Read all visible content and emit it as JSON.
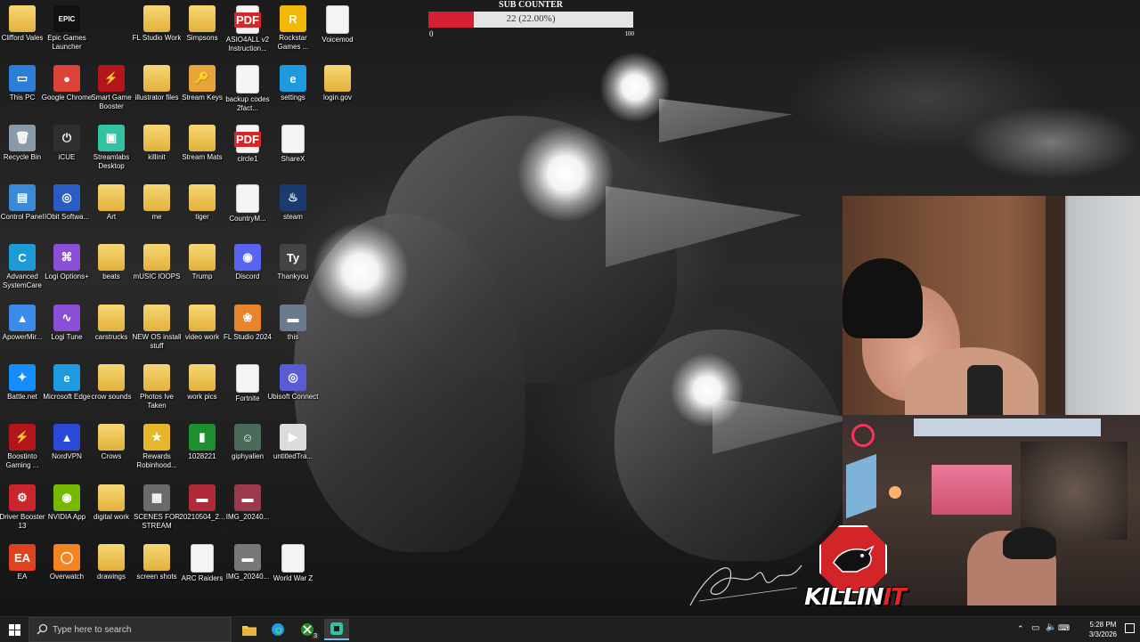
{
  "desktop": {
    "icons": [
      {
        "label": "Clifford Vales",
        "type": "folder"
      },
      {
        "label": "Epic Games Launcher",
        "type": "app",
        "glyph": "EPIC",
        "color": "#111111"
      },
      {
        "label": "FL Studio Work",
        "type": "folder"
      },
      {
        "label": "Simpsons",
        "type": "folder"
      },
      {
        "label": "ASIO4ALL v2 Instruction...",
        "type": "pdf"
      },
      {
        "label": "Rockstar Games ...",
        "type": "app",
        "glyph": "R",
        "color": "#f2b807"
      },
      {
        "label": "Voicemod",
        "type": "file"
      },
      {
        "label": "This PC",
        "type": "app",
        "glyph": "▭",
        "color": "#2b7fd6"
      },
      {
        "label": "Google Chrome",
        "type": "round",
        "glyph": "●",
        "color": "#db4437"
      },
      {
        "label": "Smart Game Booster",
        "type": "round",
        "glyph": "⚡",
        "color": "#b3151b"
      },
      {
        "label": "illustrator files",
        "type": "folder"
      },
      {
        "label": "Stream Keys",
        "type": "app",
        "glyph": "🔑",
        "color": "#e8a33a"
      },
      {
        "label": "backup codes 2fact...",
        "type": "file"
      },
      {
        "label": "settings",
        "type": "round",
        "glyph": "e",
        "color": "#1e9be0"
      },
      {
        "label": "login.gov",
        "type": "folder"
      },
      {
        "label": "Recycle Bin",
        "type": "app",
        "glyph": "🗑",
        "color": "#8a9aa8"
      },
      {
        "label": "iCUE",
        "type": "round",
        "glyph": "⏻",
        "color": "#2f2f2f"
      },
      {
        "label": "Streamlabs Desktop",
        "type": "app",
        "glyph": "▣",
        "color": "#31c3a2"
      },
      {
        "label": "killinit",
        "type": "folder"
      },
      {
        "label": "Stream Mats",
        "type": "folder"
      },
      {
        "label": "circle1",
        "type": "pdf"
      },
      {
        "label": "ShareX",
        "type": "file"
      },
      {
        "label": "Control Panel",
        "type": "app",
        "glyph": "▤",
        "color": "#3a8ad8"
      },
      {
        "label": "IObit Softwa...",
        "type": "round",
        "glyph": "◎",
        "color": "#2a5cc4"
      },
      {
        "label": "Art",
        "type": "folder"
      },
      {
        "label": "me",
        "type": "folder"
      },
      {
        "label": "tiger",
        "type": "folder"
      },
      {
        "label": "CountryM...",
        "type": "file"
      },
      {
        "label": "steam",
        "type": "round",
        "glyph": "♨",
        "color": "#1b3b6f"
      },
      {
        "label": "Advanced SystemCare",
        "type": "round",
        "glyph": "C",
        "color": "#1d9bd7"
      },
      {
        "label": "Logi Options+",
        "type": "app",
        "glyph": "⌘",
        "color": "#8a4fd6"
      },
      {
        "label": "beats",
        "type": "folder"
      },
      {
        "label": "mUSIC lOOPS",
        "type": "folder"
      },
      {
        "label": "Trump",
        "type": "folder"
      },
      {
        "label": "Discord",
        "type": "round",
        "glyph": "◉",
        "color": "#5865f2"
      },
      {
        "label": "Thankyou",
        "type": "app",
        "glyph": "Ty",
        "color": "#444444"
      },
      {
        "label": "ApowerMir...",
        "type": "app",
        "glyph": "▲",
        "color": "#3d8be8"
      },
      {
        "label": "Logi Tune",
        "type": "round",
        "glyph": "∿",
        "color": "#8a4fd6"
      },
      {
        "label": "carstrucks",
        "type": "folder"
      },
      {
        "label": "NEW OS install stuff",
        "type": "folder"
      },
      {
        "label": "video work",
        "type": "folder"
      },
      {
        "label": "FL Studio 2024",
        "type": "round",
        "glyph": "❀",
        "color": "#e8842a"
      },
      {
        "label": "this",
        "type": "app",
        "glyph": "▬",
        "color": "#6b7a8c"
      },
      {
        "label": "Battle.net",
        "type": "round",
        "glyph": "✦",
        "color": "#148eff"
      },
      {
        "label": "Microsoft Edge",
        "type": "round",
        "glyph": "e",
        "color": "#1e9be0"
      },
      {
        "label": "crow sounds",
        "type": "folder"
      },
      {
        "label": "Photos Ive Taken",
        "type": "folder"
      },
      {
        "label": "work pics",
        "type": "folder"
      },
      {
        "label": "Fortnite",
        "type": "file"
      },
      {
        "label": "Ubisoft Connect",
        "type": "round",
        "glyph": "◎",
        "color": "#5b5bd6"
      },
      {
        "label": "Boostinto Gaming ...",
        "type": "round",
        "glyph": "⚡",
        "color": "#b3151b"
      },
      {
        "label": "NordVPN",
        "type": "round",
        "glyph": "▲",
        "color": "#2a49d6"
      },
      {
        "label": "Crows",
        "type": "folder"
      },
      {
        "label": "Rewards Robinhood...",
        "type": "app",
        "glyph": "★",
        "color": "#e8b62a"
      },
      {
        "label": "1028221",
        "type": "app",
        "glyph": "▮",
        "color": "#1d8f2e"
      },
      {
        "label": "giphyalien",
        "type": "app",
        "glyph": "☺",
        "color": "#4a6a5a"
      },
      {
        "label": "untitledTra...",
        "type": "app",
        "glyph": "▶",
        "color": "#dcdcdc"
      },
      {
        "label": "Driver Booster 13",
        "type": "round",
        "glyph": "⚙",
        "color": "#c9252c"
      },
      {
        "label": "NVIDIA App",
        "type": "app",
        "glyph": "◉",
        "color": "#76b900"
      },
      {
        "label": "digital work",
        "type": "folder"
      },
      {
        "label": "SCENES FOR STREAM",
        "type": "app",
        "glyph": "▦",
        "color": "#6a6a6a"
      },
      {
        "label": "20210504_2...",
        "type": "app",
        "glyph": "▬",
        "color": "#b02a3a"
      },
      {
        "label": "IMG_20240...",
        "type": "app",
        "glyph": "▬",
        "color": "#9a3a4a"
      },
      {
        "label": "EA",
        "type": "round",
        "glyph": "EA",
        "color": "#e0421f"
      },
      {
        "label": "Overwatch",
        "type": "round",
        "glyph": "◯",
        "color": "#f4841f"
      },
      {
        "label": "drawings",
        "type": "folder"
      },
      {
        "label": "screen shots",
        "type": "folder"
      },
      {
        "label": "ARC Raiders",
        "type": "file"
      },
      {
        "label": "IMG_20240...",
        "type": "app",
        "glyph": "▬",
        "color": "#777777"
      },
      {
        "label": "World War Z",
        "type": "file"
      }
    ]
  },
  "sub_counter": {
    "title": "SUB COUNTER",
    "value_text": "22 (22.00%)",
    "progress": 0.22,
    "min_label": "0",
    "max_label": "100",
    "fill_color": "#d61f33"
  },
  "overlay": {
    "logo_text_white": "KILLIN",
    "logo_text_red": "IT"
  },
  "taskbar": {
    "search_placeholder": "Type here to search",
    "apps": [
      "file-explorer",
      "microsoft-edge",
      "xbox",
      "streamlabs"
    ],
    "xbox_badge": "3",
    "time": "5:28 PM",
    "date": "3/3/2026"
  }
}
